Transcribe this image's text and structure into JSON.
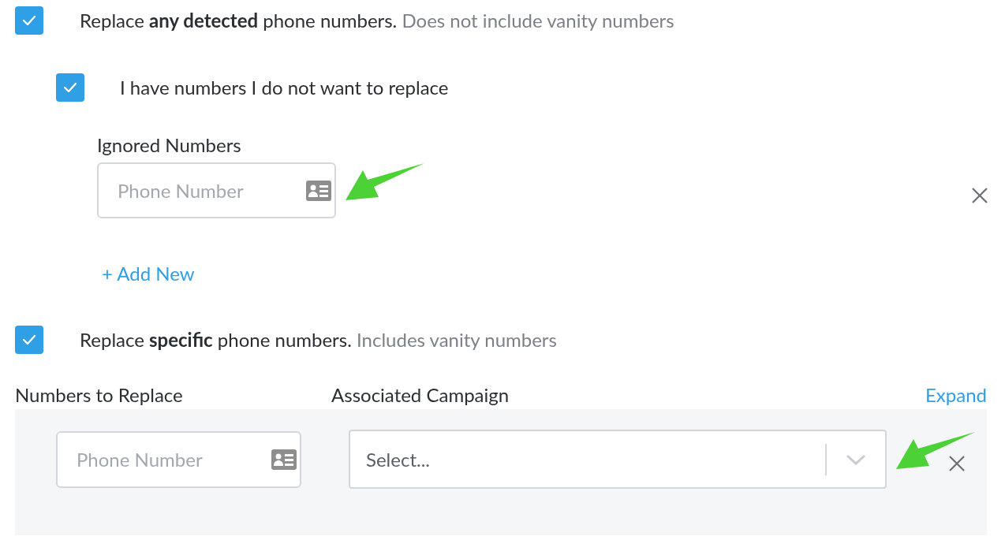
{
  "detected": {
    "checked": true,
    "label": "Replace **any detected** phone numbers.",
    "hint": "Does not include vanity numbers"
  },
  "exceptions": {
    "checked": true,
    "label": "I have numbers I do not want to replace",
    "field_label": "Ignored Numbers",
    "placeholder": "Phone Number",
    "add_link": "+ Add New"
  },
  "specific": {
    "checked": true,
    "label": "Replace **specific** phone numbers.",
    "hint": "Includes vanity numbers",
    "columns": [
      "Numbers to Replace",
      "Associated Campaign"
    ],
    "expand_link": "Expand",
    "rows": [
      {
        "placeholder": "Phone Number",
        "campaign_placeholder": "Select..."
      }
    ]
  }
}
